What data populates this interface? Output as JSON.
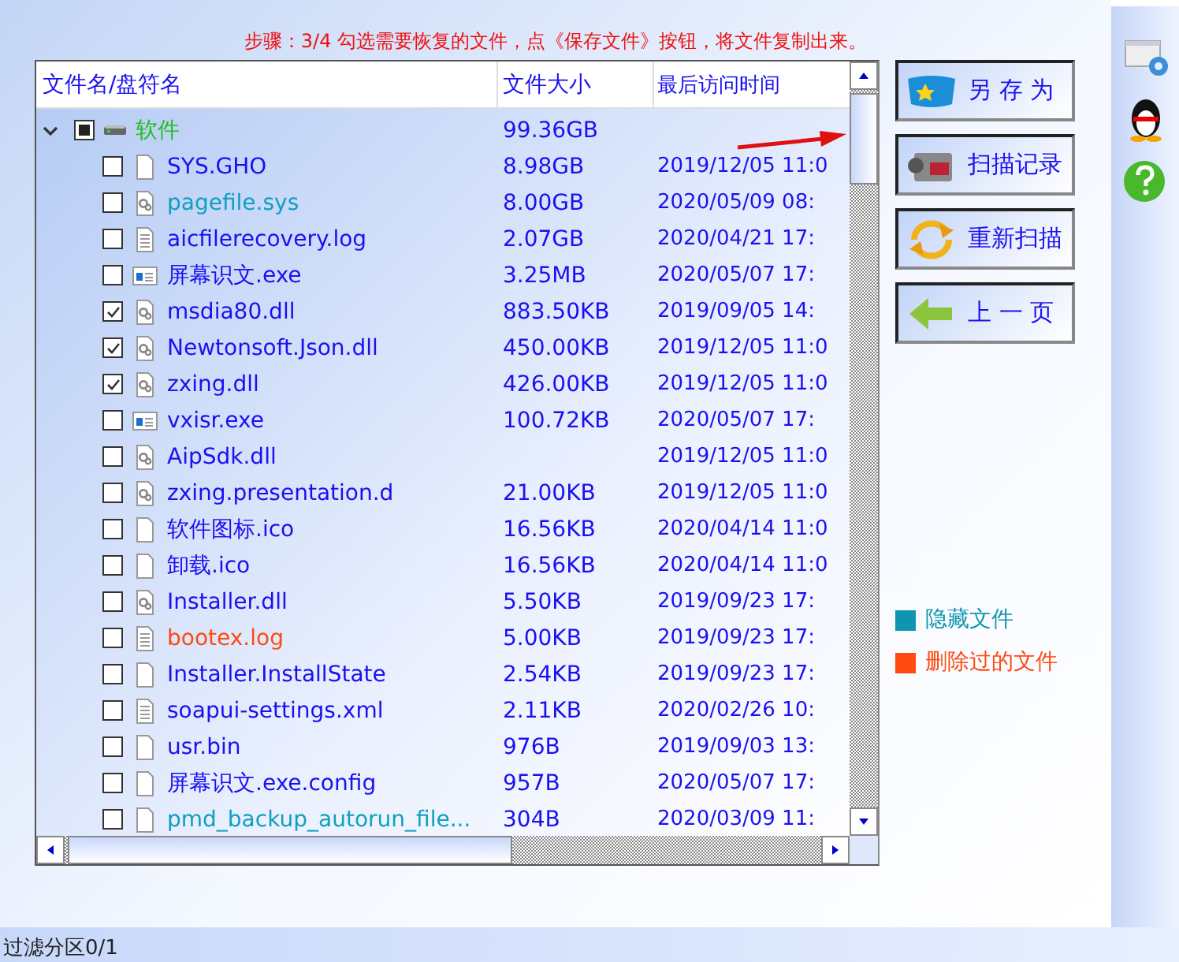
{
  "instruction": "步骤：3/4 勾选需要恢复的文件，点《保存文件》按钮，将文件复制出来。",
  "table": {
    "columns": [
      "文件名/盘符名",
      "文件大小",
      "最后访问时间"
    ],
    "root": {
      "name": "软件",
      "size": "99.36GB",
      "expanded": true,
      "partial": true
    },
    "rows": [
      {
        "name": "SYS.GHO",
        "size": "8.98GB",
        "date": "2019/12/05 11:0",
        "kind": "blank",
        "color": "#1a10f0",
        "checked": false
      },
      {
        "name": "pagefile.sys",
        "size": "8.00GB",
        "date": "2020/05/09 08:",
        "kind": "dll",
        "color": "#10a0c0",
        "checked": false
      },
      {
        "name": "aicfilerecovery.log",
        "size": "2.07GB",
        "date": "2020/04/21 17:",
        "kind": "text",
        "color": "#1a10f0",
        "checked": false
      },
      {
        "name": "屏幕识文.exe",
        "size": "3.25MB",
        "date": "2020/05/07 17:",
        "kind": "exe",
        "color": "#1a10f0",
        "checked": false
      },
      {
        "name": "msdia80.dll",
        "size": "883.50KB",
        "date": "2019/09/05 14:",
        "kind": "dll",
        "color": "#1a10f0",
        "checked": true
      },
      {
        "name": "Newtonsoft.Json.dll",
        "size": "450.00KB",
        "date": "2019/12/05 11:0",
        "kind": "dll",
        "color": "#1a10f0",
        "checked": true
      },
      {
        "name": "zxing.dll",
        "size": "426.00KB",
        "date": "2019/12/05 11:0",
        "kind": "dll",
        "color": "#1a10f0",
        "checked": true
      },
      {
        "name": "vxisr.exe",
        "size": "100.72KB",
        "date": "2020/05/07 17:",
        "kind": "exe",
        "color": "#1a10f0",
        "checked": false
      },
      {
        "name": "AipSdk.dll",
        "date": "2019/12/05 11:0",
        "kind": "dll",
        "color": "#1a10f0",
        "checked": false
      },
      {
        "name": "zxing.presentation.d",
        "size": "21.00KB",
        "date": "2019/12/05 11:0",
        "kind": "dll",
        "color": "#1a10f0",
        "checked": false
      },
      {
        "name": "软件图标.ico",
        "size": "16.56KB",
        "date": "2020/04/14 11:0",
        "kind": "blank",
        "color": "#1a10f0",
        "checked": false
      },
      {
        "name": "卸载.ico",
        "size": "16.56KB",
        "date": "2020/04/14 11:0",
        "kind": "blank",
        "color": "#1a10f0",
        "checked": false
      },
      {
        "name": "Installer.dll",
        "size": "5.50KB",
        "date": "2019/09/23 17:",
        "kind": "dll",
        "color": "#1a10f0",
        "checked": false
      },
      {
        "name": "bootex.log",
        "size": "5.00KB",
        "date": "2019/09/23 17:",
        "kind": "text",
        "color": "#ff4a10",
        "checked": false
      },
      {
        "name": "Installer.InstallState",
        "size": "2.54KB",
        "date": "2019/09/23 17:",
        "kind": "blank",
        "color": "#1a10f0",
        "checked": false
      },
      {
        "name": "soapui-settings.xml",
        "size": "2.11KB",
        "date": "2020/02/26 10:",
        "kind": "text",
        "color": "#1a10f0",
        "checked": false
      },
      {
        "name": "usr.bin",
        "size": "976B",
        "date": "2019/09/03 13:",
        "kind": "blank",
        "color": "#1a10f0",
        "checked": false
      },
      {
        "name": "屏幕识文.exe.config",
        "size": "957B",
        "date": "2020/05/07 17:",
        "kind": "blank",
        "color": "#1a10f0",
        "checked": false
      },
      {
        "name": "pmd_backup_autorun_file...",
        "size": "304B",
        "date": "2020/03/09 11:",
        "kind": "blank",
        "color": "#10a0c0",
        "checked": false
      }
    ]
  },
  "buttons": [
    {
      "label": "另 存 为",
      "kind": "save"
    },
    {
      "label": "扫描记录",
      "kind": "camera"
    },
    {
      "label": "重新扫描",
      "kind": "refresh"
    },
    {
      "label": "上 一 页",
      "kind": "back"
    }
  ],
  "legend": [
    {
      "label": "隐藏文件",
      "color": "#1095b0"
    },
    {
      "label": "删除过的文件",
      "color": "#ff4a10"
    }
  ],
  "status_bar": {
    "text": "过滤分区0/1"
  }
}
